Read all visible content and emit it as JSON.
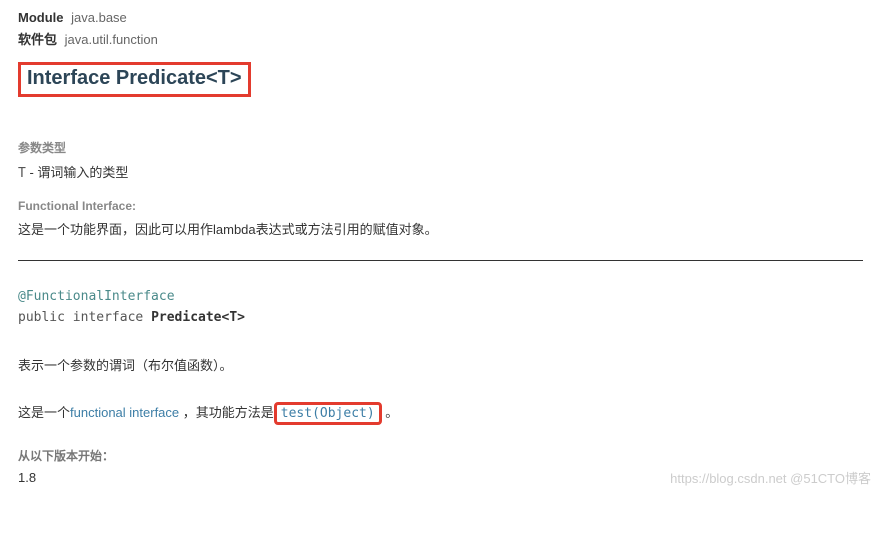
{
  "header": {
    "module_label": "Module",
    "module_value": "java.base",
    "package_label": "软件包",
    "package_value": "java.util.function"
  },
  "title": "Interface Predicate<T>",
  "params": {
    "section_label": "参数类型",
    "param_name": "T",
    "param_desc": " - 谓词输入的类型"
  },
  "functional_interface": {
    "label": "Functional Interface:",
    "desc": "这是一个功能界面，因此可以用作lambda表达式或方法引用的赋值对象。"
  },
  "signature": {
    "annotation": "@FunctionalInterface",
    "prefix": "public interface ",
    "name": "Predicate<T>"
  },
  "description1": "表示一个参数的谓词（布尔值函数）。",
  "description2": {
    "prefix": "这是一个",
    "link": "functional interface",
    "mid": " ，其功能方法是",
    "method": "test(Object)",
    "suffix": " 。"
  },
  "since": {
    "label": "从以下版本开始：",
    "value": "1.8"
  },
  "watermark": "https://blog.csdn.net   @51CTO博客"
}
